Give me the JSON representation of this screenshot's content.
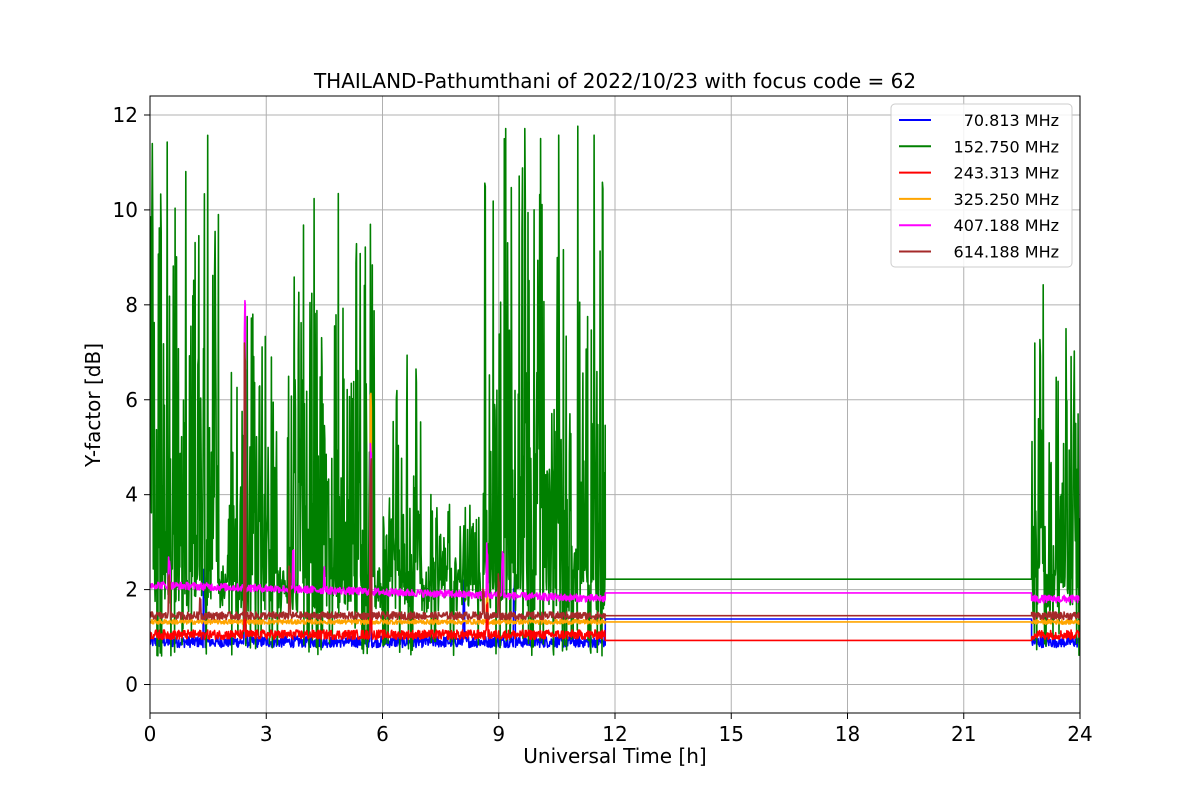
{
  "chart_data": {
    "type": "line",
    "title": "THAILAND-Pathumthani of 2022/10/23 with focus code = 62",
    "xlabel": "Universal Time [h]",
    "ylabel": "Y-factor [dB]",
    "xlim": [
      0,
      24
    ],
    "ylim": [
      -0.6,
      12.4
    ],
    "xticks": [
      0,
      3,
      6,
      9,
      12,
      15,
      18,
      21,
      24
    ],
    "yticks": [
      0,
      2,
      4,
      6,
      8,
      10,
      12
    ],
    "grid": true,
    "legend_position": "top-right",
    "series": [
      {
        "name": "70.813 MHz",
        "color": "#0000ff",
        "baseline": 0.9,
        "noise": 0.12,
        "gap_value": 1.38,
        "spikes": [
          [
            1.4,
            2.5
          ],
          [
            2.45,
            4.0
          ],
          [
            5.7,
            4.5
          ],
          [
            8.1,
            2.3
          ],
          [
            9.4,
            2.3
          ]
        ]
      },
      {
        "name": "152.750 MHz",
        "color": "#008000",
        "baseline": 2.0,
        "noise": 0.5,
        "gap_value": 2.22,
        "bursts": [
          {
            "x": [
              0,
              1.8
            ],
            "max": 11.7
          },
          {
            "x": [
              2.0,
              3.3
            ],
            "max": 8.7
          },
          {
            "x": [
              3.5,
              5.8
            ],
            "max": 10.7
          },
          {
            "x": [
              6.0,
              7.0
            ],
            "max": 7.0
          },
          {
            "x": [
              7.2,
              8.5
            ],
            "max": 4.2
          },
          {
            "x": [
              8.6,
              11.75
            ],
            "max": 11.8
          },
          {
            "x": [
              22.75,
              24
            ],
            "max": 9.1
          }
        ]
      },
      {
        "name": "243.313 MHz",
        "color": "#ff0000",
        "baseline": 1.05,
        "noise": 0.1,
        "gap_value": 0.93,
        "spikes": [
          [
            2.45,
            2.7
          ],
          [
            5.7,
            2.0
          ],
          [
            8.7,
            1.8
          ]
        ]
      },
      {
        "name": "325.250 MHz",
        "color": "#ffa500",
        "baseline": 1.32,
        "noise": 0.05,
        "gap_value": 1.32,
        "spikes": [
          [
            2.45,
            6.0
          ],
          [
            5.7,
            6.3
          ],
          [
            8.7,
            2.2
          ]
        ]
      },
      {
        "name": "407.188 MHz",
        "color": "#ff00ff",
        "baseline": 2.1,
        "end_value": 1.8,
        "noise": 0.08,
        "gap_value": 1.93,
        "spikes": [
          [
            0.5,
            2.8
          ],
          [
            2.45,
            8.3
          ],
          [
            3.7,
            2.9
          ],
          [
            4.5,
            2.6
          ],
          [
            5.7,
            5.5
          ],
          [
            8.7,
            3.0
          ],
          [
            9.1,
            2.9
          ]
        ]
      },
      {
        "name": "614.188 MHz",
        "color": "#a52a2a",
        "baseline": 1.45,
        "noise": 0.08,
        "gap_value": 1.45,
        "spikes": [
          [
            0.5,
            2.5
          ],
          [
            1.3,
            2.0
          ],
          [
            2.45,
            7.5
          ],
          [
            3.6,
            2.5
          ],
          [
            5.7,
            4.8
          ],
          [
            8.6,
            2.3
          ],
          [
            9.0,
            2.5
          ]
        ]
      }
    ],
    "data_gap": [
      11.75,
      22.75
    ]
  }
}
